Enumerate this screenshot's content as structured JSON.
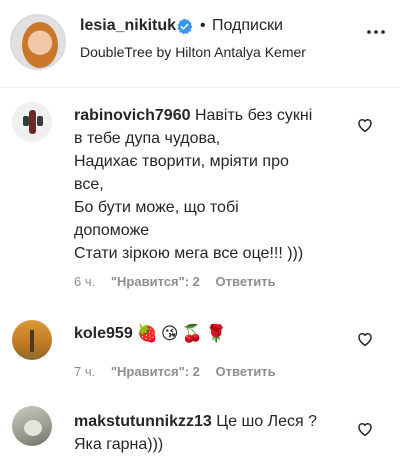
{
  "post": {
    "username": "lesia_nikituk",
    "separator": "•",
    "follow_label": "Подписки",
    "location": "DoubleTree by Hilton Antalya Kemer"
  },
  "comments": [
    {
      "username": "rabinovich7960",
      "text": "Навіть без сукні\nв тебе дупа чудова,\nНадихає творити, мріяти про\nвсе,\nБо бути може, що тобі\nдопоможе\nСтати зіркою мега все оце!!! )))",
      "time": "6 ч.",
      "likes_label": "\"Нравится\": 2",
      "reply_label": "Ответить"
    },
    {
      "username": "kole959",
      "text": "",
      "emojis": "🍓😘🍒🌹",
      "time": "7 ч.",
      "likes_label": "\"Нравится\": 2",
      "reply_label": "Ответить"
    },
    {
      "username": "makstutunnikzz13",
      "text": "Це шо Леся ?\nЯка гарна)))"
    }
  ],
  "icons": {
    "verified": "verified-badge-icon",
    "more": "more-options-icon",
    "like": "heart-icon"
  },
  "colors": {
    "verified": "#3897f0",
    "text": "#262626",
    "muted": "#8e8e8e"
  }
}
